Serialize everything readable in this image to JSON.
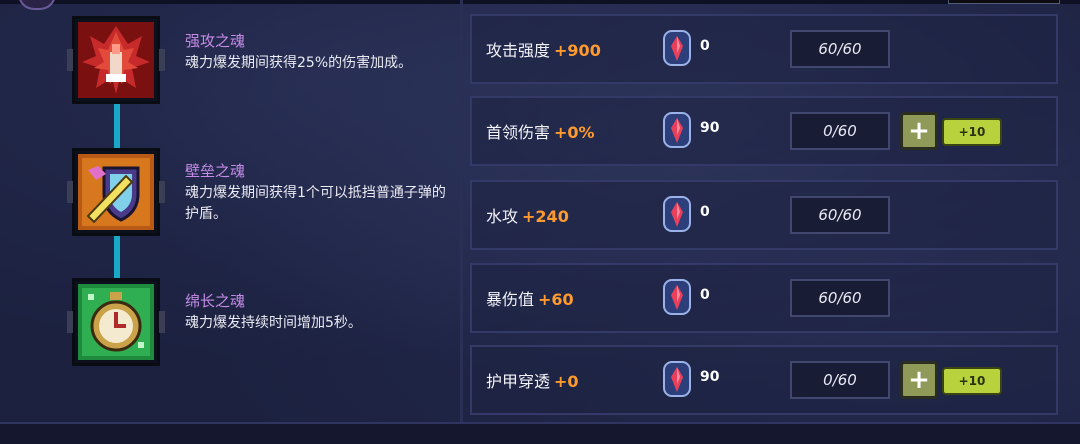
{
  "skills": [
    {
      "name": "强攻之魂",
      "desc": "魂力爆发期间获得25%的伤害加成。",
      "icon": "red-wolf-armor-icon"
    },
    {
      "name": "壁垒之魂",
      "desc": "魂力爆发期间获得1个可以抵挡普通子弹的护盾。",
      "icon": "shield-sword-icon"
    },
    {
      "name": "绵长之魂",
      "desc": "魂力爆发持续时间增加5秒。",
      "icon": "stopwatch-icon"
    }
  ],
  "stats": [
    {
      "label": "攻击强度",
      "bonus": "+900",
      "cost": "0",
      "progress": "60/60",
      "upgradable": false
    },
    {
      "label": "首领伤害",
      "bonus": "+0%",
      "cost": "90",
      "progress": "0/60",
      "upgradable": true
    },
    {
      "label": "水攻",
      "bonus": "+240",
      "cost": "0",
      "progress": "60/60",
      "upgradable": false
    },
    {
      "label": "暴伤值",
      "bonus": "+60",
      "cost": "0",
      "progress": "60/60",
      "upgradable": false
    },
    {
      "label": "护甲穿透",
      "bonus": "+0",
      "cost": "90",
      "progress": "0/60",
      "upgradable": true
    }
  ],
  "buttons": {
    "plus": "+",
    "plus10": "+10"
  },
  "colors": {
    "skill_name": "#c48be6",
    "bonus": "#ff9a2e",
    "connector": "#1aa8c8",
    "plus10_button": "#b7d23c",
    "plus_button": "#8f9a58"
  }
}
